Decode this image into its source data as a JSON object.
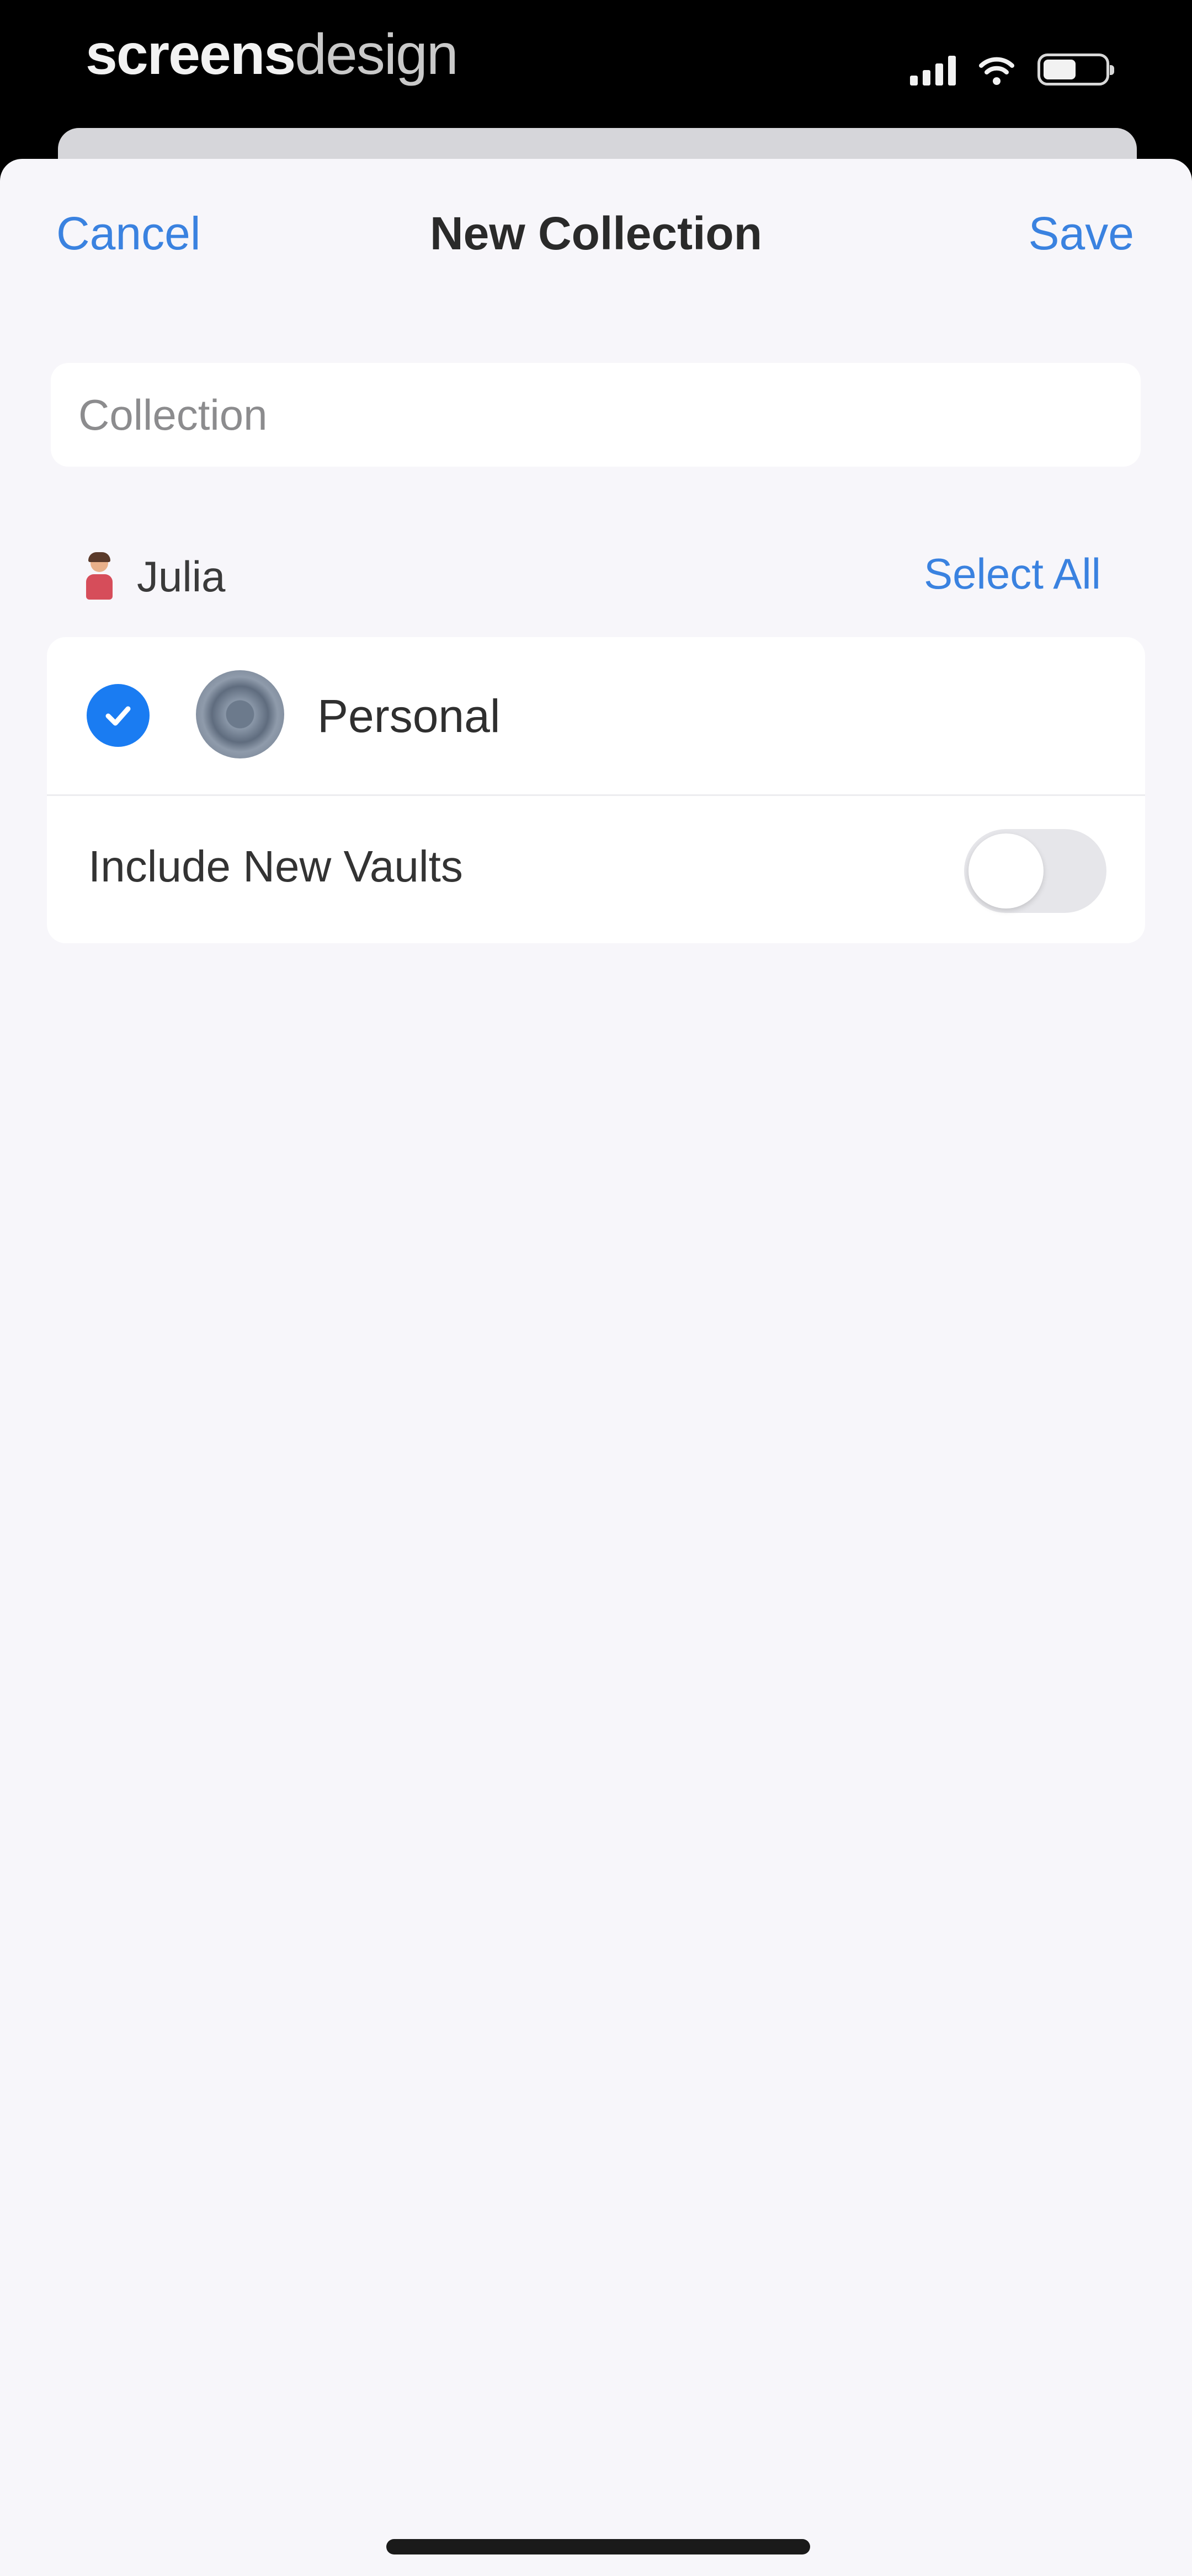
{
  "status_bar": {
    "watermark_bold": "screens",
    "watermark_light": "design",
    "signal_icon": "cellular-signal-icon",
    "wifi_icon": "wifi-icon",
    "battery_icon": "battery-icon",
    "battery_level": 0.5
  },
  "nav": {
    "cancel_label": "Cancel",
    "title": "New Collection",
    "save_label": "Save"
  },
  "name_field": {
    "placeholder": "Collection",
    "value": ""
  },
  "account": {
    "name": "Julia",
    "avatar_icon": "user-avatar-icon",
    "select_all_label": "Select All"
  },
  "vaults": [
    {
      "label": "Personal",
      "checked": true,
      "icon": "vault-icon"
    }
  ],
  "include_new_vaults": {
    "label": "Include New Vaults",
    "enabled": false
  },
  "colors": {
    "accent": "#3a82e0",
    "checkbox": "#1a7cf2",
    "background": "#f7f6fa"
  }
}
